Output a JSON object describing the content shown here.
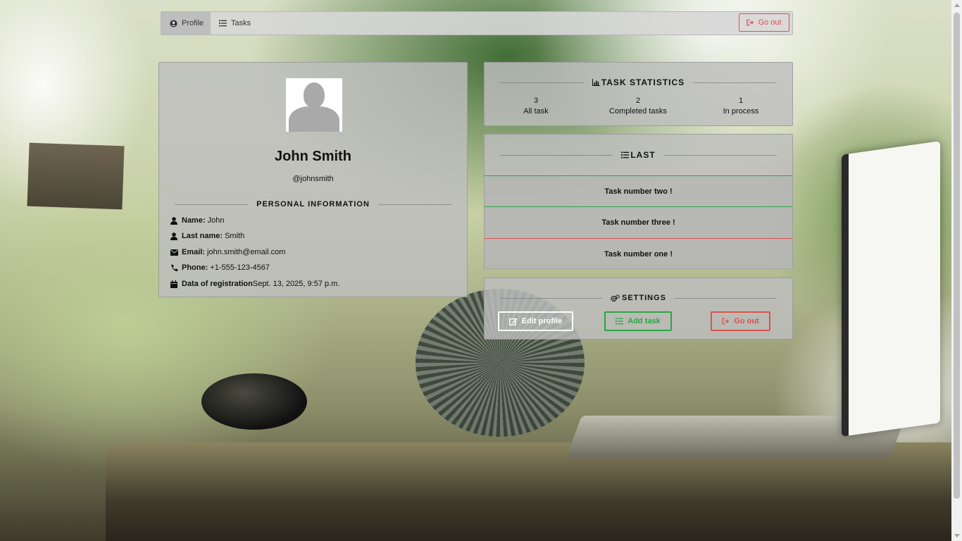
{
  "navbar": {
    "tabs": [
      {
        "label": "Profile",
        "icon": "user-circle-icon",
        "active": true
      },
      {
        "label": "Tasks",
        "icon": "list-icon",
        "active": false
      }
    ],
    "go_out_label": "Go out"
  },
  "profile": {
    "name": "John Smith",
    "handle": "@johnsmith",
    "section_title": "PERSONAL INFORMATION",
    "rows": [
      {
        "icon": "user-icon",
        "label": "Name:",
        "value": "John"
      },
      {
        "icon": "user-icon",
        "label": "Last name:",
        "value": "Smith"
      },
      {
        "icon": "envelope-icon",
        "label": "Email:",
        "value": "john.smith@email.com"
      },
      {
        "icon": "phone-icon",
        "label": "Phone:",
        "value": "+1-555-123-4567"
      },
      {
        "icon": "calendar-icon",
        "label": "Data of registration",
        "value": "Sept. 13, 2025, 9:57 p.m."
      }
    ]
  },
  "stats": {
    "title": "TASK STATISTICS",
    "items": [
      {
        "value": "3",
        "label": "All task"
      },
      {
        "value": "2",
        "label": "Completed tasks"
      },
      {
        "value": "1",
        "label": "In process"
      }
    ]
  },
  "last": {
    "title": "LAST",
    "tasks": [
      {
        "title": "Task number two !",
        "status_color": "#28a745"
      },
      {
        "title": "Task number three !",
        "status_color": "#28a745"
      },
      {
        "title": "Task number one !",
        "status_color": "#d9534f"
      }
    ]
  },
  "settings": {
    "title": "SETTINGS",
    "edit_profile_label": "Edit profile",
    "add_task_label": "Add task",
    "go_out_label": "Go out"
  },
  "colors": {
    "success": "#28a745",
    "danger": "#d9534f"
  }
}
